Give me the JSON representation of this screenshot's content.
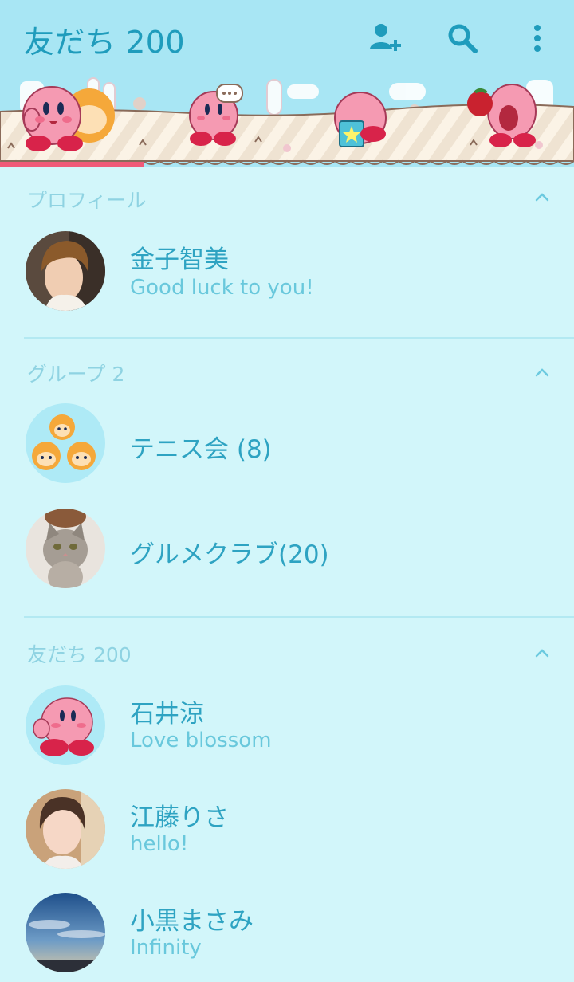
{
  "header": {
    "title": "友だち 200",
    "icons": [
      "add-friend-icon",
      "search-icon",
      "more-vertical-icon"
    ]
  },
  "sections": {
    "profile": {
      "label": "プロフィール"
    },
    "groups": {
      "label": "グループ 2"
    },
    "friends": {
      "label": "友だち 200"
    }
  },
  "profile": {
    "name": "金子智美",
    "status": "Good luck to you!"
  },
  "groups": [
    {
      "name": "テニス会 (8)"
    },
    {
      "name": "グルメクラブ(20)"
    }
  ],
  "friends": [
    {
      "name": "石井涼",
      "status": "Love blossom"
    },
    {
      "name": "江藤りさ",
      "status": "hello!"
    },
    {
      "name": "小黒まさみ",
      "status": "Infinity"
    }
  ],
  "colors": {
    "header_bg": "#a8e6f4",
    "body_bg": "#d2f6fa",
    "accent": "#1f9cbc",
    "tab_indicator": "#f05a78"
  }
}
